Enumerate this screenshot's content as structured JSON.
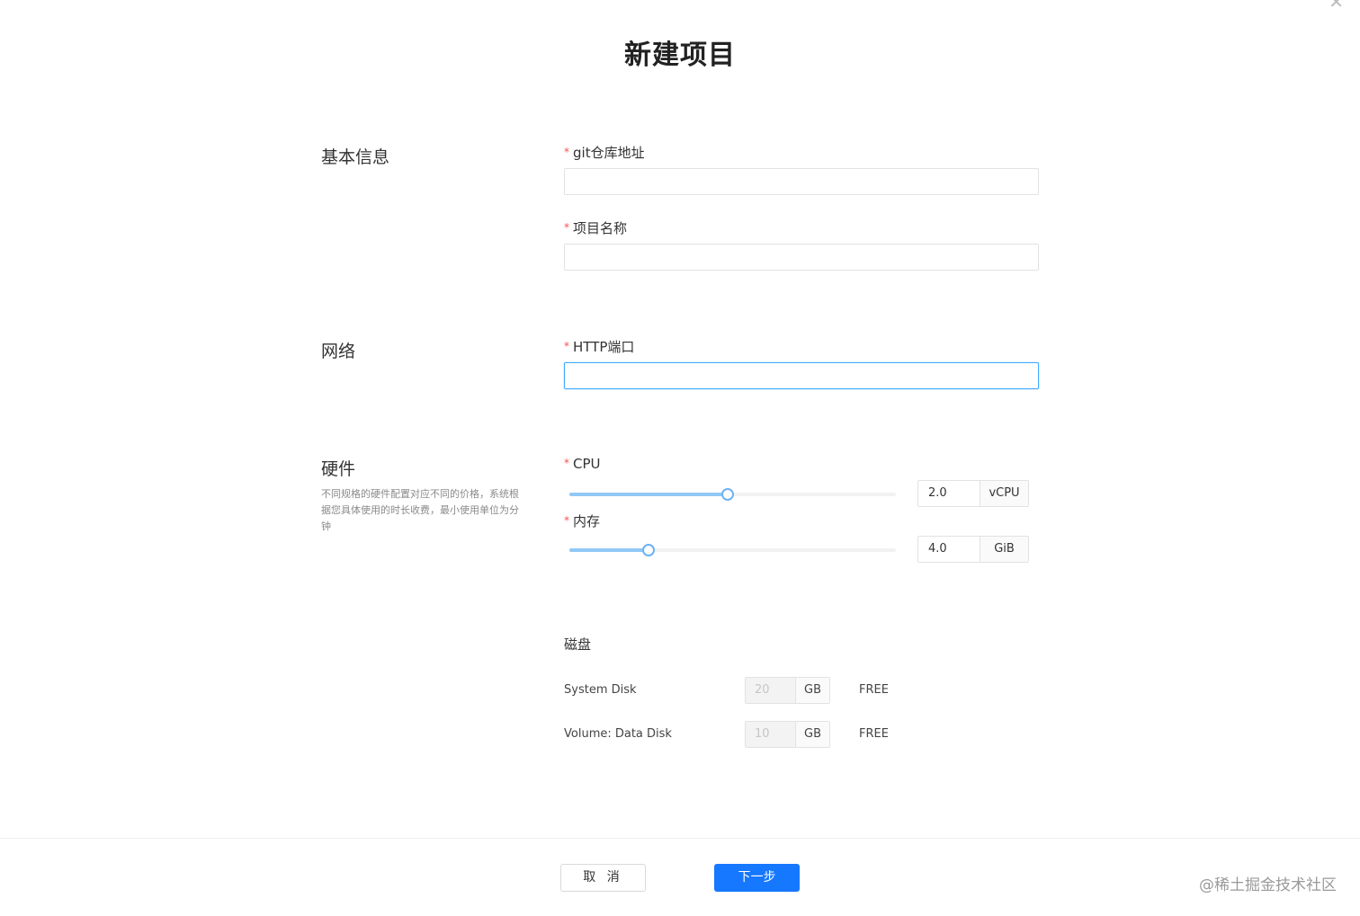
{
  "dialog": {
    "title": "新建项目",
    "close_icon": "close-icon"
  },
  "sections": {
    "basic": {
      "title": "基本信息"
    },
    "network": {
      "title": "网络"
    },
    "hardware": {
      "title": "硬件",
      "description": "不同规格的硬件配置对应不同的价格，系统根据您具体使用的时长收费，最小使用单位为分钟"
    }
  },
  "fields": {
    "required_mark": "*",
    "git_repo": {
      "label": "git仓库地址",
      "value": ""
    },
    "project_name": {
      "label": "项目名称",
      "value": ""
    },
    "http_port": {
      "label": "HTTP端口",
      "value": ""
    },
    "cpu": {
      "label": "CPU",
      "value": "2.0",
      "unit": "vCPU",
      "fill_fraction": 0.486
    },
    "memory": {
      "label": "内存",
      "value": "4.0",
      "unit": "GiB",
      "fill_fraction": 0.243
    }
  },
  "disk": {
    "title": "磁盘",
    "system": {
      "label": "System Disk",
      "value": "20",
      "unit": "GB",
      "price": "FREE"
    },
    "data": {
      "label": "Volume: Data Disk",
      "value": "10",
      "unit": "GB",
      "price": "FREE"
    }
  },
  "footer": {
    "cancel_label": "取 消",
    "next_label": "下一步"
  },
  "watermark": "@稀土掘金技术社区",
  "colors": {
    "primary": "#1677ff",
    "required": "#f5524f",
    "slider_track": "#91c8f6"
  }
}
